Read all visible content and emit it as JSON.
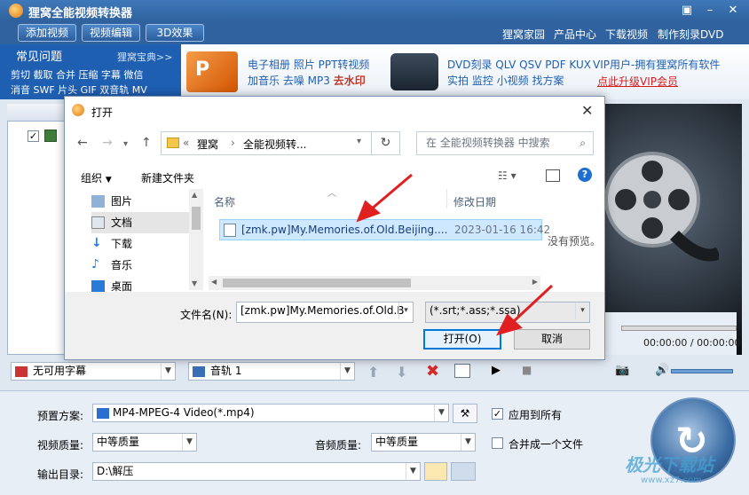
{
  "app": {
    "title": "狸窝全能视频转换器",
    "top_links": [
      "狸窝家园",
      "产品中心",
      "下载视频",
      "制作刻录DVD"
    ]
  },
  "toolbar": {
    "add_video": "添加视频",
    "edit_video": "视频编辑",
    "effect_3d": "3D效果"
  },
  "banner": {
    "faq_title": "常见问题",
    "faq_treasure": "狸窝宝典>>",
    "faq_row1": "剪切 截取 合并 压缩 字幕 微信",
    "faq_row2": "消音 SWF 片头 GIF 双音轨 MV",
    "ad1_line1": "电子相册 照片 PPT转视频",
    "ad1_line2a": "加音乐 去噪 MP3",
    "ad1_line2b": "去水印",
    "ad2_line1": "DVD刻录 QLV QSV PDF KUX",
    "ad2_line2": "实拍 监控 小视频 找方案",
    "vip_line1": "VIP用户-拥有狸窝所有软件",
    "vip_line2": "点此升级VIP会员"
  },
  "player": {
    "timecode": "00:00:00 / 00:00:00"
  },
  "controls": {
    "subtitle": "无可用字幕",
    "audio_track": "音轨 1"
  },
  "settings": {
    "preset_label": "预置方案:",
    "preset_value": "MP4-MPEG-4 Video(*.mp4)",
    "apply_all": "应用到所有",
    "video_quality_label": "视频质量:",
    "video_quality_value": "中等质量",
    "audio_quality_label": "音频质量:",
    "audio_quality_value": "中等质量",
    "merge_label": "合并成一个文件",
    "output_label": "输出目录:",
    "output_value": "D:\\解压"
  },
  "watermark": {
    "line1": "极光下载站",
    "line2": "www.xz7.com"
  },
  "dialog": {
    "title": "打开",
    "breadcrumb_root": "狸窝",
    "breadcrumb_child": "全能视频转...",
    "search_placeholder": "在 全能视频转换器 中搜索",
    "organize": "组织",
    "new_folder": "新建文件夹",
    "tree": [
      "图片",
      "文档",
      "下载",
      "音乐",
      "桌面"
    ],
    "col_name": "名称",
    "col_date": "修改日期",
    "file_name": "[zmk.pw]My.Memories.of.Old.Beijing....",
    "file_date": "2023-01-16 16:42",
    "no_preview": "没有预览。",
    "filename_label": "文件名(N):",
    "filename_value": "[zmk.pw]My.Memories.of.Old.B",
    "filetype": "(*.srt;*.ass;*.ssa)",
    "open_button": "打开(O)",
    "cancel_button": "取消"
  }
}
